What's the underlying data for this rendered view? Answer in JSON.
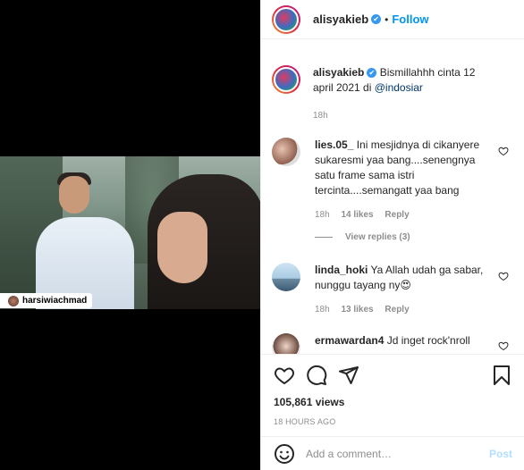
{
  "media": {
    "tag_username": "harsiwiachmad"
  },
  "header": {
    "username": "alisyakieb",
    "verified_badge": "✔",
    "separator": "•",
    "follow_label": "Follow"
  },
  "caption": {
    "username": "alisyakieb",
    "text": "Bismillahhh cinta 12 april 2021 di ",
    "mention": "@indosiar",
    "time": "18h"
  },
  "comments": [
    {
      "username": "lies.05_",
      "text": "Ini mesjidnya di cikanyere sukaresmi yaa bang....senengnya satu frame sama istri tercinta....semangatt yaa bang",
      "time": "18h",
      "likes": "14 likes",
      "reply_label": "Reply",
      "view_replies": "View replies (3)"
    },
    {
      "username": "linda_hoki",
      "text": "Ya Allah udah ga sabar, nunggu tayang ny😍",
      "time": "18h",
      "likes": "13 likes",
      "reply_label": "Reply"
    },
    {
      "username": "ermawardan4",
      "text": "Jd inget rock'nroll"
    }
  ],
  "stats": {
    "views": "105,861 views",
    "timestamp": "18 HOURS AGO"
  },
  "composer": {
    "placeholder": "Add a comment…",
    "post_label": "Post"
  },
  "colors": {
    "accent": "#0095f6",
    "verified": "#3897f0",
    "post_disabled": "#b2dffc",
    "muted": "#8e8e8e"
  },
  "icons": {
    "like": "heart-icon",
    "comment": "comment-icon",
    "share": "share-icon",
    "save": "bookmark-icon",
    "emoji": "emoji-icon"
  }
}
